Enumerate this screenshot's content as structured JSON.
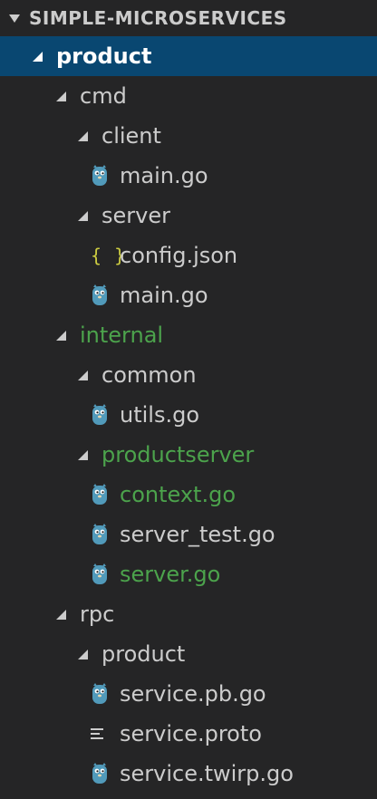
{
  "explorer": {
    "section_title": "SIMPLE-MICROSERVICES",
    "colors": {
      "background": "#252526",
      "selected_row": "#094771",
      "text": "#cccccc",
      "modified_text": "#4ca34c",
      "go_icon": "#519aba",
      "json_icon": "#cbcb41"
    },
    "tree": [
      {
        "label": "product",
        "type": "folder",
        "expanded": true,
        "selected": true,
        "depth": 0
      },
      {
        "label": "cmd",
        "type": "folder",
        "expanded": true,
        "depth": 1
      },
      {
        "label": "client",
        "type": "folder",
        "expanded": true,
        "depth": 2
      },
      {
        "label": "main.go",
        "type": "file",
        "icon": "go-gopher-icon",
        "depth": 3
      },
      {
        "label": "server",
        "type": "folder",
        "expanded": true,
        "depth": 2
      },
      {
        "label": "config.json",
        "type": "file",
        "icon": "json-braces-icon",
        "depth": 3
      },
      {
        "label": "main.go",
        "type": "file",
        "icon": "go-gopher-icon",
        "depth": 3
      },
      {
        "label": "internal",
        "type": "folder",
        "expanded": true,
        "modified": true,
        "depth": 1
      },
      {
        "label": "common",
        "type": "folder",
        "expanded": true,
        "depth": 2
      },
      {
        "label": "utils.go",
        "type": "file",
        "icon": "go-gopher-icon",
        "depth": 3
      },
      {
        "label": "productserver",
        "type": "folder",
        "expanded": true,
        "modified": true,
        "depth": 2
      },
      {
        "label": "context.go",
        "type": "file",
        "icon": "go-gopher-icon",
        "modified": true,
        "depth": 3
      },
      {
        "label": "server_test.go",
        "type": "file",
        "icon": "go-gopher-icon",
        "depth": 3
      },
      {
        "label": "server.go",
        "type": "file",
        "icon": "go-gopher-icon",
        "modified": true,
        "depth": 3
      },
      {
        "label": "rpc",
        "type": "folder",
        "expanded": true,
        "depth": 1
      },
      {
        "label": "product",
        "type": "folder",
        "expanded": true,
        "depth": 2
      },
      {
        "label": "service.pb.go",
        "type": "file",
        "icon": "go-gopher-icon",
        "depth": 3
      },
      {
        "label": "service.proto",
        "type": "file",
        "icon": "proto-lines-icon",
        "depth": 3
      },
      {
        "label": "service.twirp.go",
        "type": "file",
        "icon": "go-gopher-icon",
        "depth": 3
      }
    ]
  }
}
